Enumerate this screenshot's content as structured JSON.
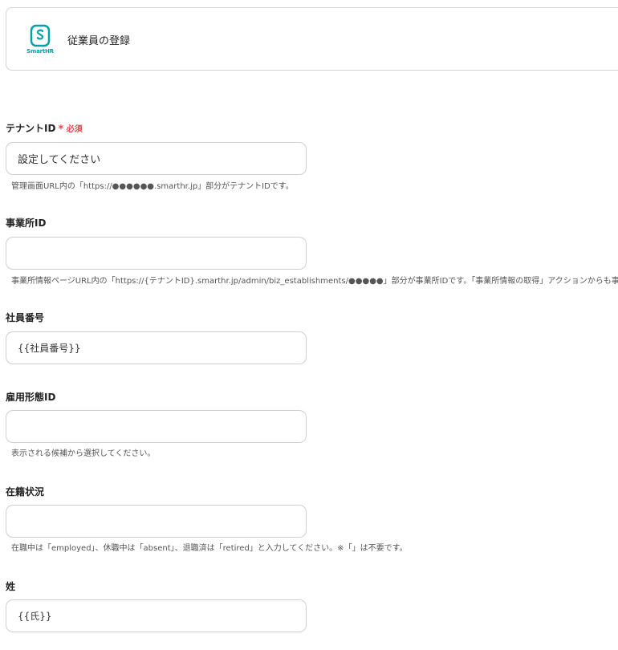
{
  "header": {
    "logo_text": "SmartHR",
    "title": "従業員の登録",
    "brand_color": "#00a1a9"
  },
  "fields": [
    {
      "label": "テナントID",
      "required": true,
      "required_label": "必須",
      "value": "",
      "placeholder": "設定してください",
      "help": "管理画面URL内の「https://●●●●●●.smarthr.jp」部分がテナントIDです。"
    },
    {
      "label": "事業所ID",
      "required": false,
      "value": "",
      "placeholder": "",
      "help": "事業所情報ページURL内の「https://{テナントID}.smarthr.jp/admin/biz_establishments/●●●●●」部分が事業所IDです。「事業所情報の取得」アクションからも事業"
    },
    {
      "label": "社員番号",
      "required": false,
      "value": "{{社員番号}}",
      "placeholder": "",
      "help": ""
    },
    {
      "label": "雇用形態ID",
      "required": false,
      "value": "",
      "placeholder": "",
      "help": "表示される候補から選択してください。"
    },
    {
      "label": "在籍状況",
      "required": false,
      "value": "",
      "placeholder": "",
      "help": "在職中は「employed」、休職中は「absent」、退職済は「retired」と入力してください。※「」は不要です。"
    },
    {
      "label": "姓",
      "required": false,
      "value": "{{氏}}",
      "placeholder": "",
      "help": ""
    }
  ],
  "colors": {
    "required": "#e4454b",
    "border": "#cfcfcf"
  }
}
